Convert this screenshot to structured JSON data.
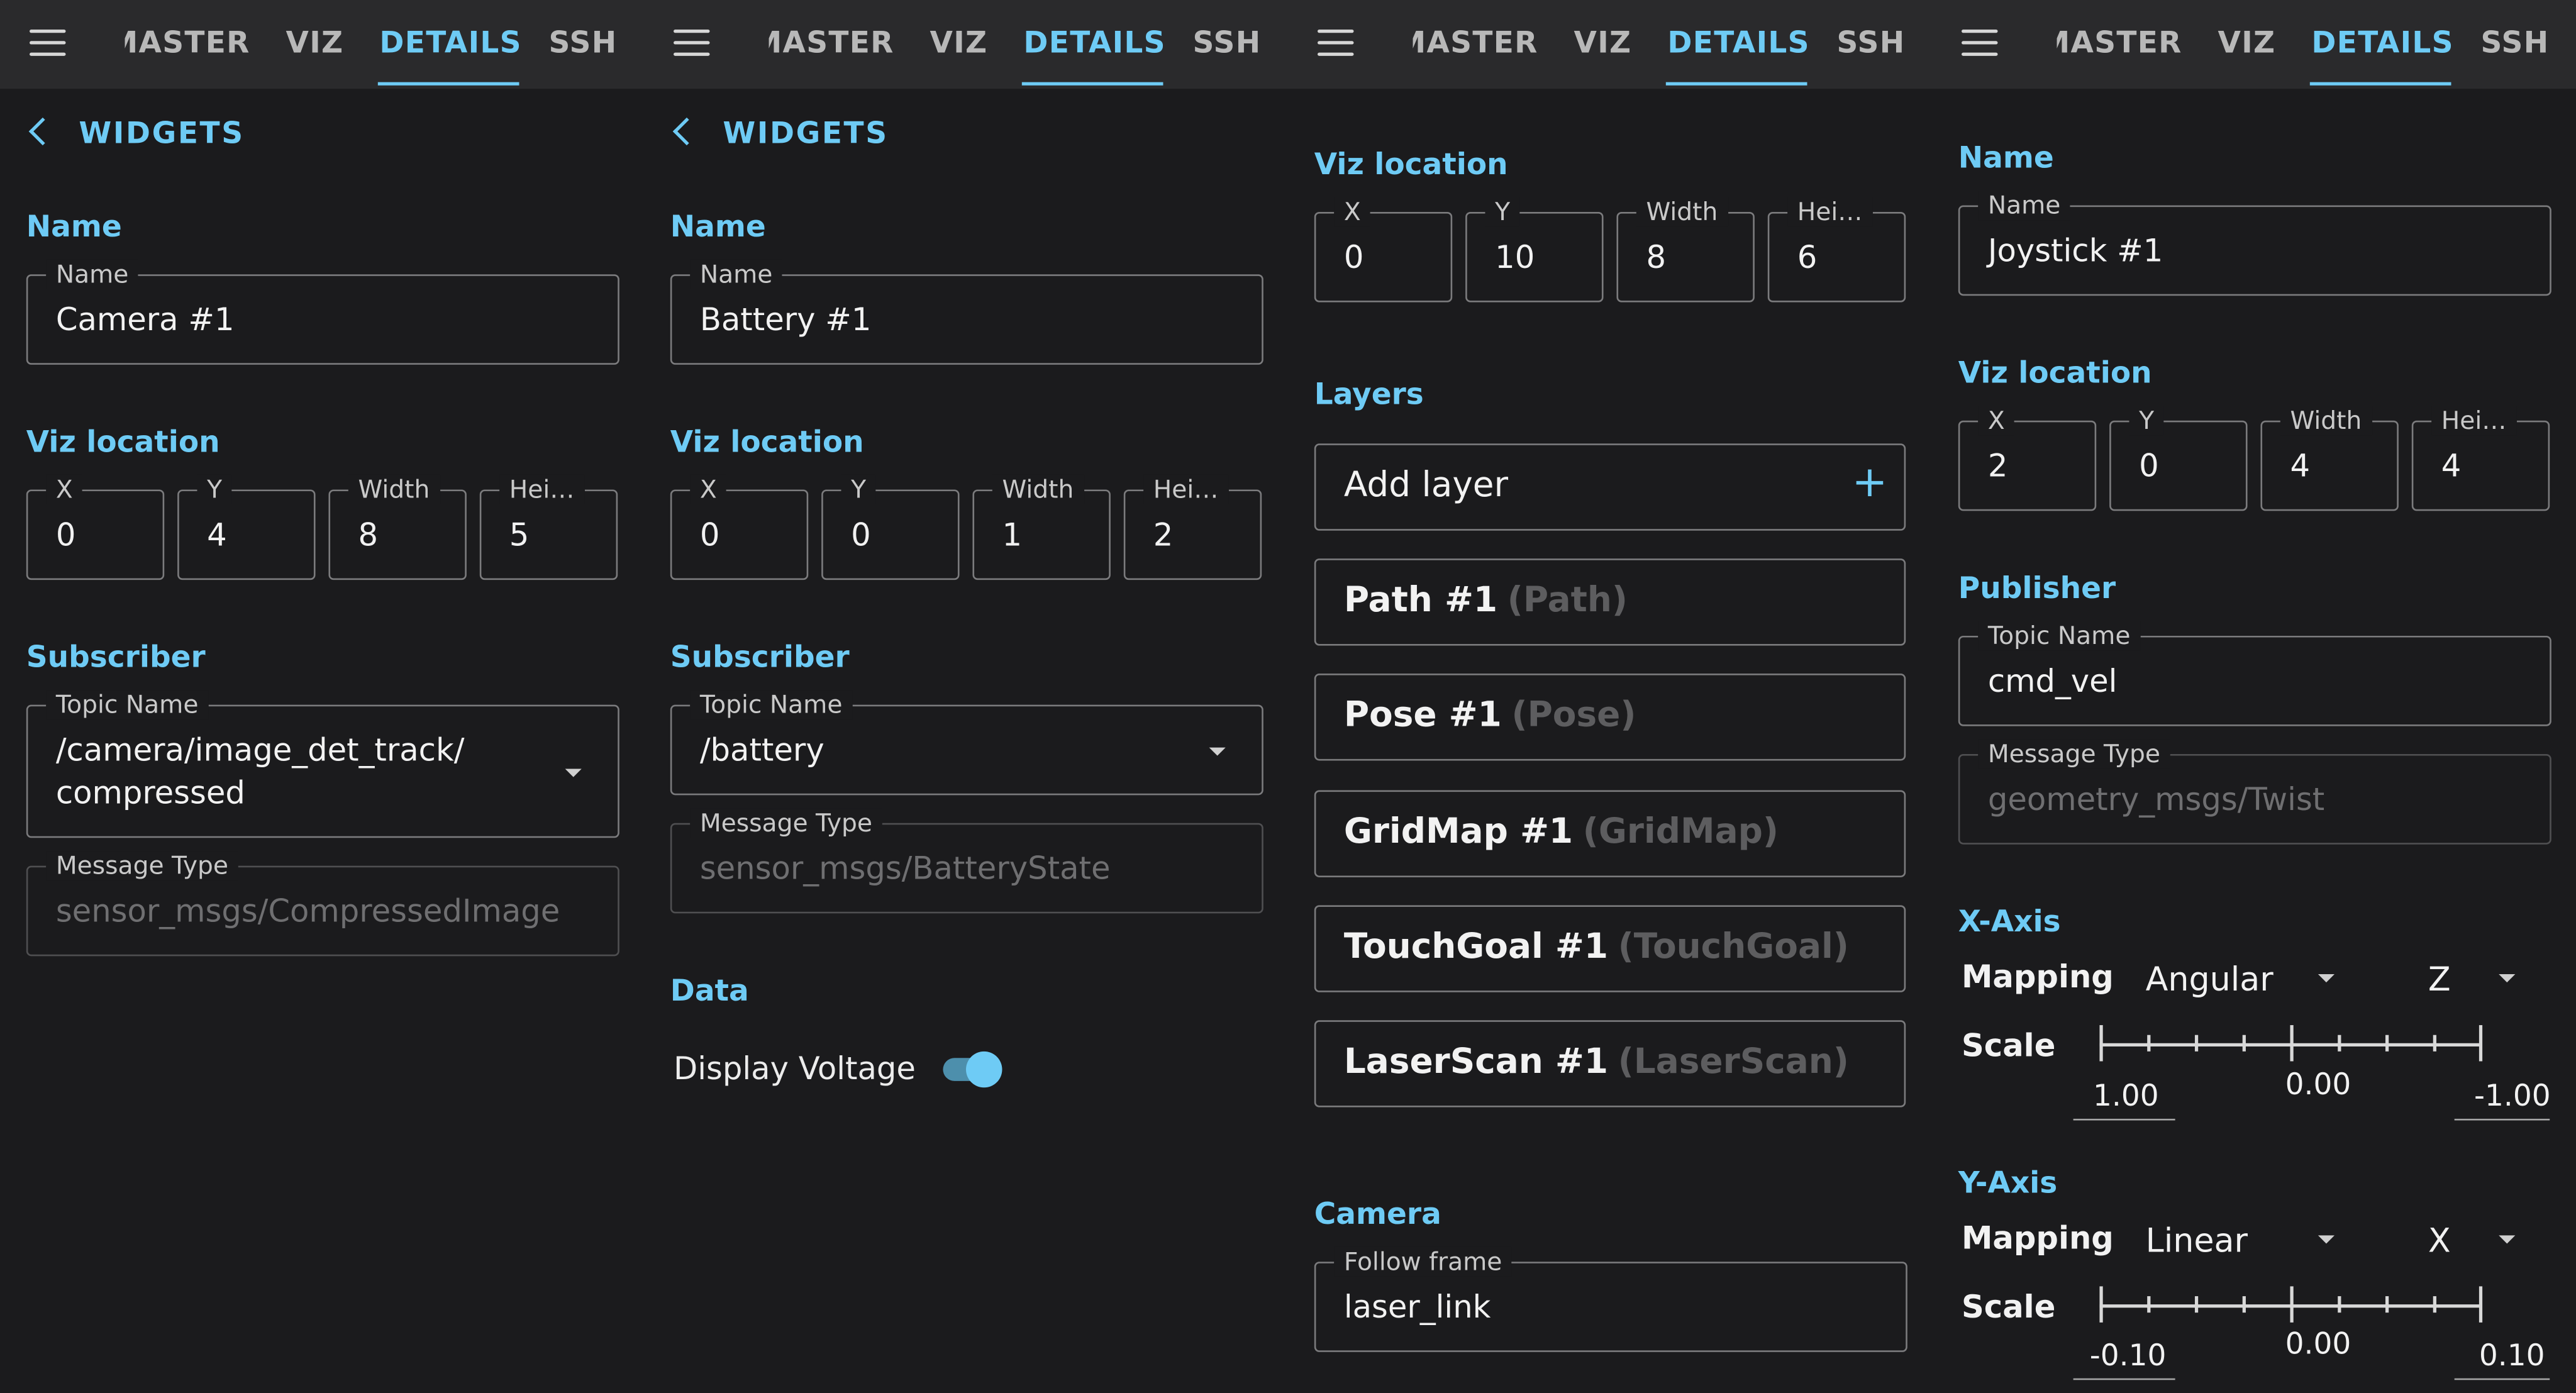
{
  "tabs": {
    "master": "MASTER",
    "viz": "VIZ",
    "details": "DETAILS",
    "ssh": "SSH"
  },
  "colors": {
    "accent": "#6ecbf5",
    "background": "#1b1b1d",
    "topbar": "#2a2a2c"
  },
  "icons": {
    "menu": "hamburger-menu-icon",
    "back": "chevron-left-icon",
    "add": "plus-icon",
    "dropdown": "caret-down-icon"
  },
  "camera_panel": {
    "back_label": "WIDGETS",
    "name_section": "Name",
    "name_field": {
      "label": "Name",
      "value": "Camera #1"
    },
    "viz_section": "Viz location",
    "viz": {
      "x_label": "X",
      "x": "0",
      "y_label": "Y",
      "y": "4",
      "w_label": "Width",
      "w": "8",
      "h_label": "Hei…",
      "h": "5"
    },
    "subscriber_section": "Subscriber",
    "topic_field": {
      "label": "Topic Name",
      "value": "/camera/image_det_track/ compressed"
    },
    "msgtype_field": {
      "label": "Message Type",
      "value": "sensor_msgs/CompressedImage"
    }
  },
  "battery_panel": {
    "back_label": "WIDGETS",
    "name_section": "Name",
    "name_field": {
      "label": "Name",
      "value": "Battery #1"
    },
    "viz_section": "Viz location",
    "viz": {
      "x_label": "X",
      "x": "0",
      "y_label": "Y",
      "y": "0",
      "w_label": "Width",
      "w": "1",
      "h_label": "Hei…",
      "h": "2"
    },
    "subscriber_section": "Subscriber",
    "topic_field": {
      "label": "Topic Name",
      "value": "/battery"
    },
    "msgtype_field": {
      "label": "Message Type",
      "value": "sensor_msgs/BatteryState"
    },
    "data_section": "Data",
    "display_voltage": {
      "label": "Display Voltage",
      "on": true
    }
  },
  "viz_panel": {
    "viz_section": "Viz location",
    "viz": {
      "x_label": "X",
      "x": "0",
      "y_label": "Y",
      "y": "10",
      "w_label": "Width",
      "w": "8",
      "h_label": "Hei…",
      "h": "6"
    },
    "layers_section": "Layers",
    "add_layer": "Add layer",
    "layers": [
      {
        "name": "Path #1",
        "type": "(Path)"
      },
      {
        "name": "Pose #1",
        "type": "(Pose)"
      },
      {
        "name": "GridMap #1",
        "type": "(GridMap)"
      },
      {
        "name": "TouchGoal #1",
        "type": "(TouchGoal)"
      },
      {
        "name": "LaserScan #1",
        "type": "(LaserScan)"
      }
    ],
    "camera_section": "Camera",
    "follow_frame": {
      "label": "Follow frame",
      "value": "laser_link"
    }
  },
  "joystick_panel": {
    "name_section": "Name",
    "name_field": {
      "label": "Name",
      "value": "Joystick #1"
    },
    "viz_section": "Viz location",
    "viz": {
      "x_label": "X",
      "x": "2",
      "y_label": "Y",
      "y": "0",
      "w_label": "Width",
      "w": "4",
      "h_label": "Hei…",
      "h": "4"
    },
    "publisher_section": "Publisher",
    "topic_field": {
      "label": "Topic Name",
      "value": "cmd_vel"
    },
    "msgtype_field": {
      "label": "Message Type",
      "value": "geometry_msgs/Twist"
    },
    "x_axis": {
      "title": "X-Axis",
      "mapping_label": "Mapping",
      "mapping": "Angular",
      "axis": "Z",
      "scale_label": "Scale",
      "min": "1.00",
      "mid": "0.00",
      "max": "-1.00"
    },
    "y_axis": {
      "title": "Y-Axis",
      "mapping_label": "Mapping",
      "mapping": "Linear",
      "axis": "X",
      "scale_label": "Scale",
      "min": "-0.10",
      "mid": "0.00",
      "max": "0.10"
    }
  }
}
